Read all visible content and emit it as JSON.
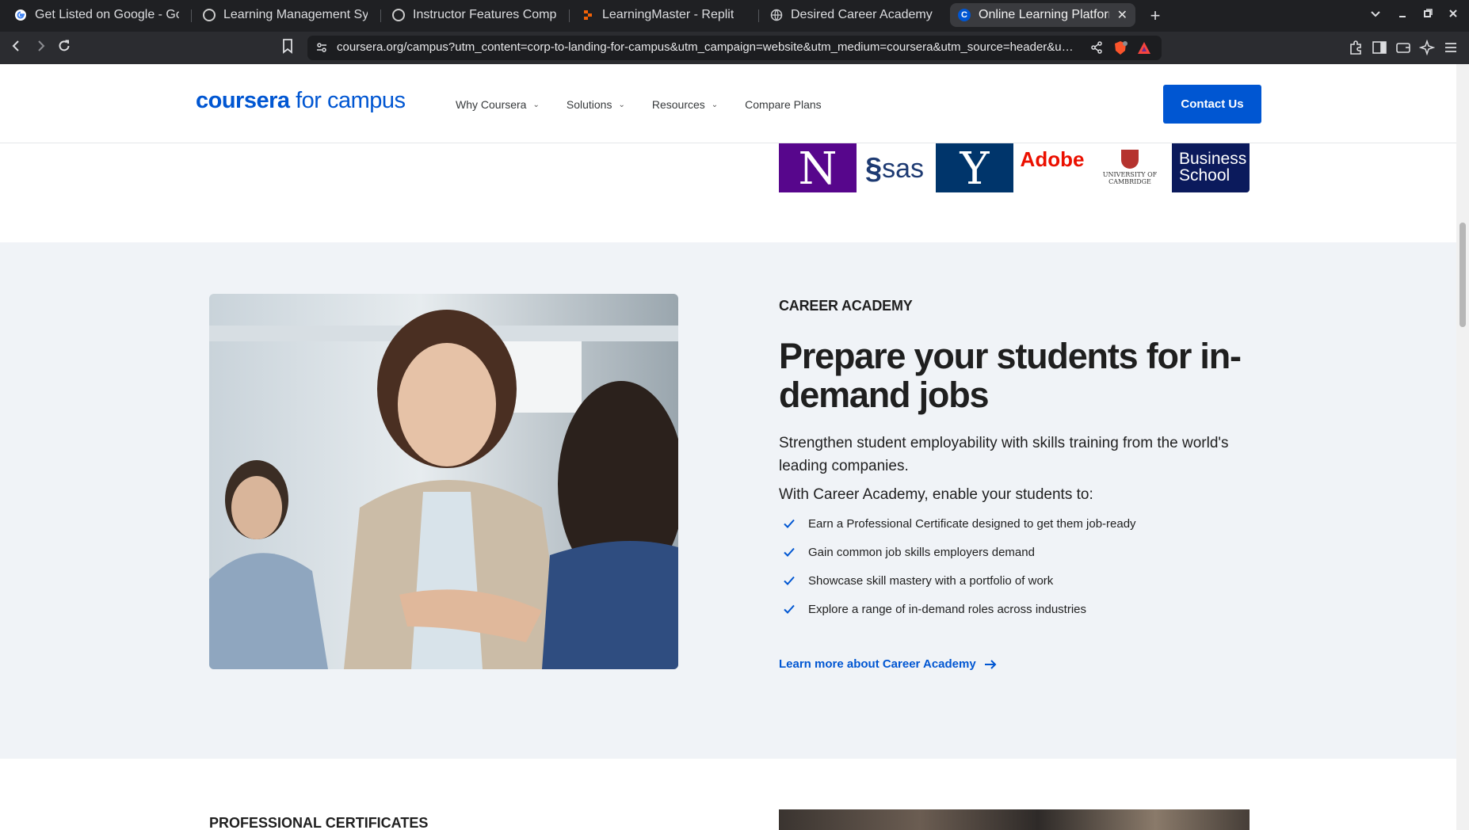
{
  "browser": {
    "tabs": [
      {
        "title": "Get Listed on Google - Goog",
        "icon": "google-icon",
        "active": false
      },
      {
        "title": "Learning Management Syste",
        "icon": "openai-icon",
        "active": false
      },
      {
        "title": "Instructor Features Compari",
        "icon": "openai-icon",
        "active": false
      },
      {
        "title": "LearningMaster - Replit",
        "icon": "replit-icon",
        "active": false
      },
      {
        "title": "Desired Career Academy | Er",
        "icon": "globe-icon",
        "active": false
      },
      {
        "title": "Online Learning Platforn",
        "icon": "coursera-icon",
        "active": true
      }
    ],
    "new_tab": "+",
    "url": "coursera.org/campus?utm_content=corp-to-landing-for-campus&utm_campaign=website&utm_medium=coursera&utm_source=header&utm_term..."
  },
  "site": {
    "logo_brand": "coursera",
    "logo_suffix": " for campus",
    "nav": [
      {
        "label": "Why Coursera",
        "has_dropdown": true
      },
      {
        "label": "Solutions",
        "has_dropdown": true
      },
      {
        "label": "Resources",
        "has_dropdown": true
      },
      {
        "label": "Compare Plans",
        "has_dropdown": false
      }
    ],
    "cta": "Contact Us"
  },
  "partner_logos": {
    "items": [
      "N",
      "sas",
      "Y",
      "Adobe",
      "UNIVERSITY OF CAMBRIDGE",
      "Business School"
    ]
  },
  "career": {
    "eyebrow": "CAREER ACADEMY",
    "heading": "Prepare your students for in-demand jobs",
    "lede": "Strengthen student employability with skills training from the world's leading companies.",
    "subhead": "With Career Academy, enable your students to:",
    "bullets": [
      "Earn a Professional Certificate designed to get them job-ready",
      "Gain common job skills employers demand",
      "Showcase skill mastery with a portfolio of work",
      "Explore a range of in-demand roles across industries"
    ],
    "link": "Learn more about Career Academy"
  },
  "next_section": {
    "eyebrow": "PROFESSIONAL CERTIFICATES"
  },
  "colors": {
    "brand": "#0056d2",
    "section_bg": "#f0f3f7",
    "text": "#1f1f1f"
  }
}
